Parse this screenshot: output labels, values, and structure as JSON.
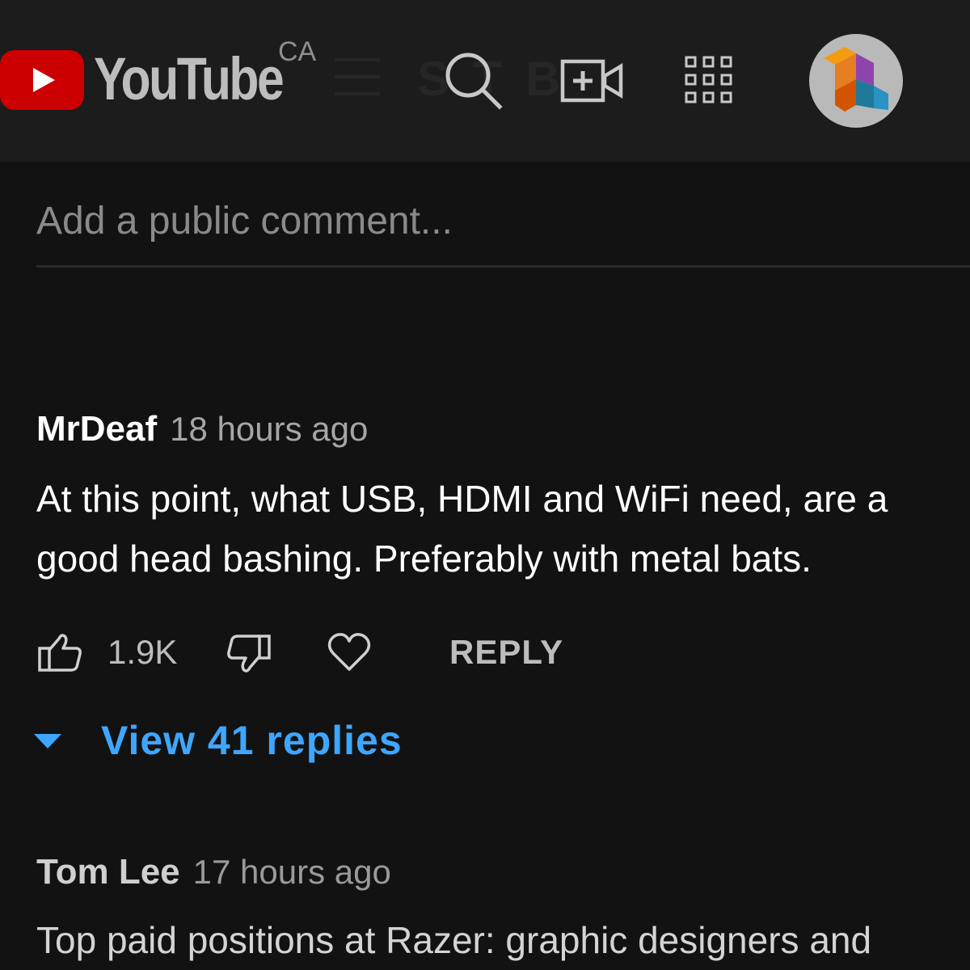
{
  "header": {
    "logo_wordmark": "YouTube",
    "country_code": "CA",
    "background_text": "S T B",
    "icons": {
      "logo": "youtube-play-logo-icon",
      "menu": "hamburger-menu-icon",
      "search": "search-icon",
      "create": "create-video-icon",
      "apps": "apps-grid-icon",
      "avatar": "channel-avatar"
    },
    "brand_color": "#cc0000"
  },
  "add_comment": {
    "placeholder": "Add a public comment..."
  },
  "comments": [
    {
      "author": "MrDeaf",
      "time": "18 hours ago",
      "lines": [
        "At this point, what USB, HDMI and WiFi need, are a",
        "good head bashing. Preferably with metal bats."
      ],
      "likes": "1.9K",
      "reply_label": "REPLY",
      "view_replies_label": "View 41 replies"
    },
    {
      "author": "Tom Lee",
      "time": "17 hours ago",
      "lines": [
        "Top paid positions at Razer: graphic designers and"
      ]
    }
  ],
  "colors": {
    "background": "#121212",
    "header": "#1c1c1c",
    "link": "#3ea6ff"
  }
}
